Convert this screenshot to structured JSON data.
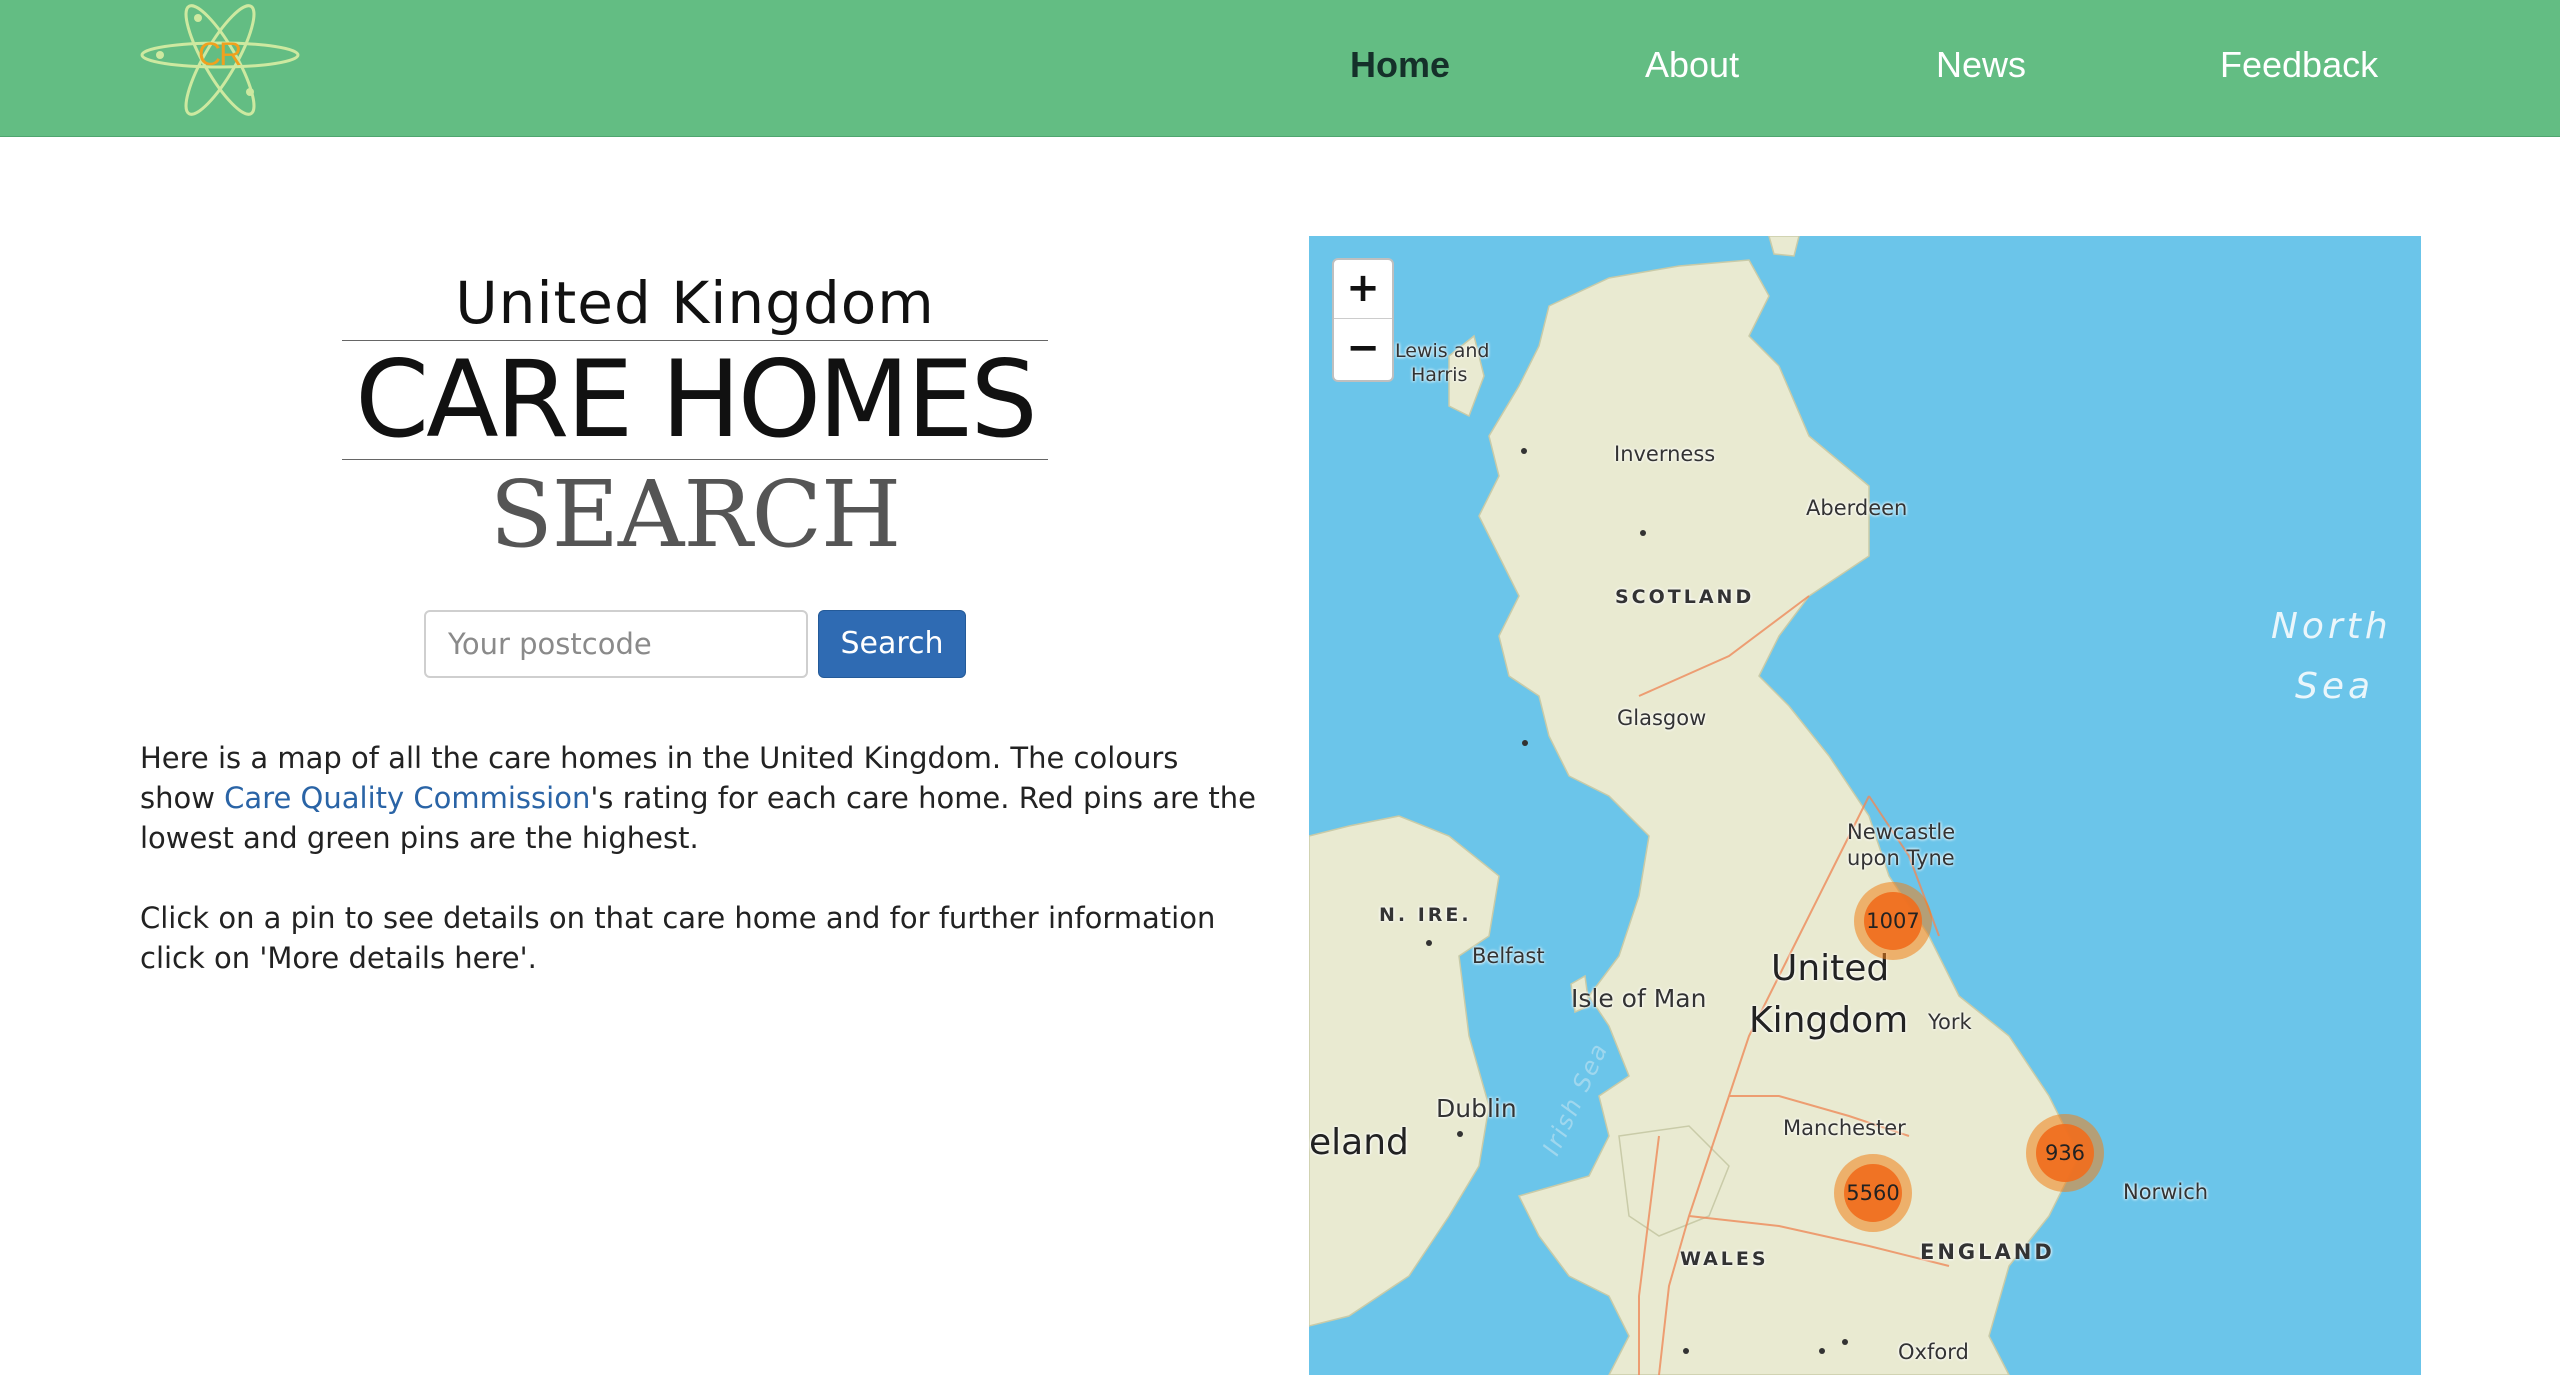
{
  "nav": {
    "logo_text": "CR",
    "items": [
      {
        "label": "Home",
        "active": true
      },
      {
        "label": "About",
        "active": false
      },
      {
        "label": "News",
        "active": false
      },
      {
        "label": "Feedback",
        "active": false
      }
    ]
  },
  "hero": {
    "line1": "United Kingdom",
    "line2": "CARE HOMES",
    "line3": "SEARCH"
  },
  "search": {
    "placeholder": "Your postcode",
    "value": "",
    "button_label": "Search"
  },
  "intro": {
    "p1_before": "Here is a map of all the care homes in the United Kingdom. The colours show ",
    "p1_link": "Care Quality Commission",
    "p1_after": "'s rating for each care home. Red pins are the lowest and green pins are the highest.",
    "p2": "Click on a pin to see details on that care home and for further information click on 'More details here'."
  },
  "map": {
    "zoom_in": "+",
    "zoom_out": "−",
    "labels": {
      "lewis": "Lewis and",
      "harris": "Harris",
      "inverness": "Inverness",
      "aberdeen": "Aberdeen",
      "scotland": "SCOTLAND",
      "north": "North",
      "sea": "Sea",
      "glasgow": "Glasgow",
      "newcastle": "Newcastle",
      "upon_tyne": "upon Tyne",
      "n_ire": "N. IRE.",
      "belfast": "Belfast",
      "isle_of_man": "Isle of Man",
      "united": "United",
      "kingdom": "Kingdom",
      "york": "York",
      "dublin": "Dublin",
      "ireland": "eland",
      "irish_sea": "Irish Sea",
      "manchester": "Manchester",
      "norwich": "Norwich",
      "wales": "WALES",
      "england": "ENGLAND",
      "oxford": "Oxford"
    },
    "clusters": [
      {
        "count": "1007"
      },
      {
        "count": "936"
      },
      {
        "count": "5560"
      }
    ],
    "colors": {
      "water": "#6bc5ea",
      "land": "#e9ead1",
      "cluster": "#f08a2a"
    }
  }
}
